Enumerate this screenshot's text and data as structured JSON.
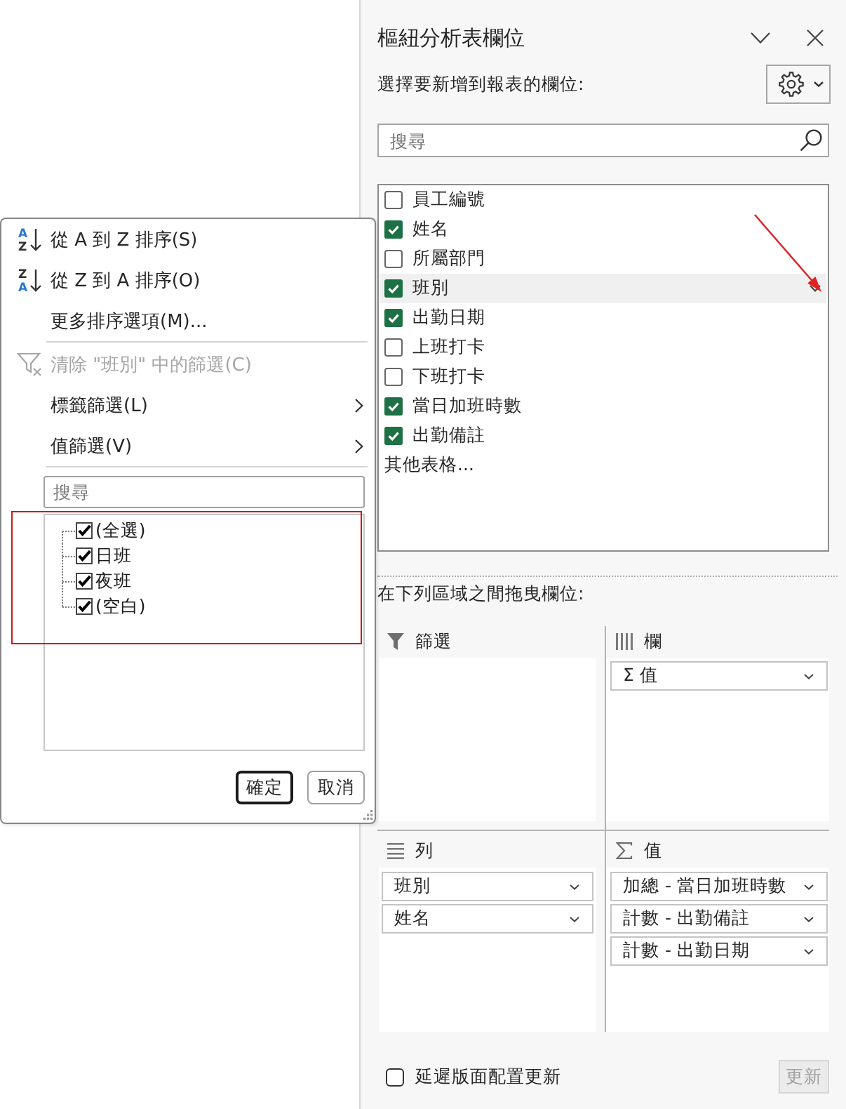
{
  "pane": {
    "title": "樞紐分析表欄位",
    "subtitle": "選擇要新增到報表的欄位:",
    "search": {
      "placeholder": "搜尋"
    },
    "fields": [
      {
        "label": "員工編號",
        "checked": false,
        "hovered": false
      },
      {
        "label": "姓名",
        "checked": true,
        "hovered": false
      },
      {
        "label": "所屬部門",
        "checked": false,
        "hovered": false
      },
      {
        "label": "班別",
        "checked": true,
        "hovered": true
      },
      {
        "label": "出勤日期",
        "checked": true,
        "hovered": false
      },
      {
        "label": "上班打卡",
        "checked": false,
        "hovered": false
      },
      {
        "label": "下班打卡",
        "checked": false,
        "hovered": false
      },
      {
        "label": "當日加班時數",
        "checked": true,
        "hovered": false
      },
      {
        "label": "出勤備註",
        "checked": true,
        "hovered": false
      }
    ],
    "more_tables": "其他表格...",
    "areas_label": "在下列區域之間拖曳欄位:",
    "areas": [
      {
        "kind": "filters",
        "label": "篩選"
      },
      {
        "kind": "columns",
        "label": "欄",
        "items": [
          "Σ 值"
        ]
      },
      {
        "kind": "rows",
        "label": "列",
        "items": [
          "班別",
          "姓名"
        ]
      },
      {
        "kind": "values",
        "label": "值",
        "items": [
          "加總 - 當日加班時數",
          "計數 - 出勤備註",
          "計數 - 出勤日期"
        ]
      }
    ],
    "defer_update": {
      "label": "延遲版面配置更新",
      "checked": false
    },
    "update_button": {
      "label": "更新",
      "disabled": true
    }
  },
  "filter_popup": {
    "menu": [
      {
        "kind": "sort_ascending",
        "icon_letters": [
          "A",
          "Z"
        ],
        "label": "從 A 到 Z 排序(S)",
        "disabled": false
      },
      {
        "kind": "sort_descending",
        "icon_letters": [
          "Z",
          "A"
        ],
        "label": "從 Z 到 A 排序(O)",
        "disabled": false
      },
      {
        "kind": "command",
        "label": "更多排序選項(M)...",
        "disabled": false
      },
      {
        "kind": "separator"
      },
      {
        "kind": "clear_filter",
        "label": "清除 \"班別\" 中的篩選(C)",
        "disabled": true
      },
      {
        "kind": "submenu",
        "label": "標籤篩選(L)",
        "disabled": false
      },
      {
        "kind": "submenu",
        "label": "值篩選(V)",
        "disabled": false
      },
      {
        "kind": "separator"
      }
    ],
    "search": {
      "placeholder": "搜尋"
    },
    "values": [
      {
        "label": "(全選)",
        "checked": true
      },
      {
        "label": "日班",
        "checked": true
      },
      {
        "label": "夜班",
        "checked": true
      },
      {
        "label": "(空白)",
        "checked": true
      }
    ],
    "buttons": [
      {
        "label": "確定",
        "default": true
      },
      {
        "label": "取消",
        "default": false
      }
    ]
  },
  "annotations": [
    {
      "kind": "rectangle"
    },
    {
      "kind": "arrow"
    }
  ]
}
